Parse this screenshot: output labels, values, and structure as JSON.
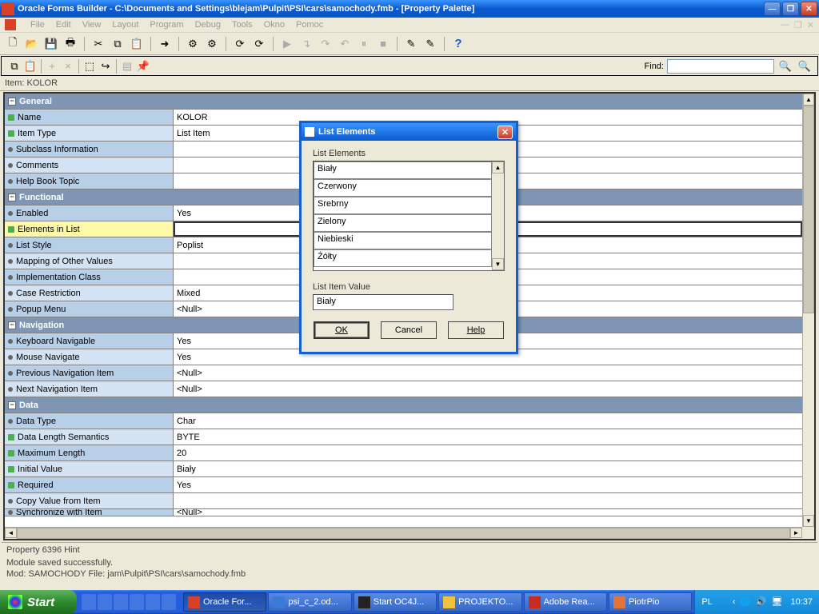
{
  "window": {
    "title": "Oracle Forms Builder - C:\\Documents and Settings\\blejam\\Pulpit\\PSI\\cars\\samochody.fmb - [Property Palette]"
  },
  "menu": {
    "file": "File",
    "edit": "Edit",
    "view": "View",
    "layout": "Layout",
    "program": "Program",
    "debug": "Debug",
    "tools": "Tools",
    "okno": "Okno",
    "pomoc": "Pomoc"
  },
  "subbar": {
    "find_label": "Find:"
  },
  "itembar": {
    "text": "Item: KOLOR"
  },
  "sections": {
    "general": "General",
    "functional": "Functional",
    "navigation": "Navigation",
    "data": "Data"
  },
  "props": {
    "name": {
      "l": "Name",
      "v": "KOLOR"
    },
    "item_type": {
      "l": "Item Type",
      "v": "List Item"
    },
    "subclass": {
      "l": "Subclass Information",
      "v": ""
    },
    "comments": {
      "l": "Comments",
      "v": ""
    },
    "help_book": {
      "l": "Help Book Topic",
      "v": ""
    },
    "enabled": {
      "l": "Enabled",
      "v": "Yes"
    },
    "elements_in_list": {
      "l": "Elements in List",
      "v": ""
    },
    "list_style": {
      "l": "List Style",
      "v": "Poplist"
    },
    "mapping": {
      "l": "Mapping of Other Values",
      "v": ""
    },
    "impl_class": {
      "l": "Implementation Class",
      "v": ""
    },
    "case_restrict": {
      "l": "Case Restriction",
      "v": "Mixed"
    },
    "popup_menu": {
      "l": "Popup Menu",
      "v": "<Null>"
    },
    "kbd_nav": {
      "l": "Keyboard Navigable",
      "v": "Yes"
    },
    "mouse_nav": {
      "l": "Mouse Navigate",
      "v": "Yes"
    },
    "prev_nav": {
      "l": "Previous Navigation Item",
      "v": "<Null>"
    },
    "next_nav": {
      "l": "Next Navigation Item",
      "v": "<Null>"
    },
    "data_type": {
      "l": "Data Type",
      "v": "Char"
    },
    "data_len_sem": {
      "l": "Data Length Semantics",
      "v": "BYTE"
    },
    "max_len": {
      "l": "Maximum Length",
      "v": "20"
    },
    "init_val": {
      "l": "Initial Value",
      "v": "Biały"
    },
    "required": {
      "l": "Required",
      "v": "Yes"
    },
    "copy_val": {
      "l": "Copy Value from Item",
      "v": ""
    },
    "sync": {
      "l": "Synchronize with Item",
      "v": "<Null>"
    }
  },
  "dialog": {
    "title": "List Elements",
    "list_label": "List Elements",
    "items": [
      "Biały",
      "Czerwony",
      "Srebrny",
      "Zielony",
      "Niebieski",
      "Żółty"
    ],
    "value_label": "List Item Value",
    "value": "Biały",
    "ok": "OK",
    "cancel": "Cancel",
    "help": "Help"
  },
  "status": {
    "hint": "Property 6396 Hint",
    "msg": "Module saved successfully.",
    "mod": "Mod: SAMOCHODY File: jam\\Pulpit\\PSI\\cars\\samochody.fmb"
  },
  "taskbar": {
    "start": "Start",
    "tasks": [
      {
        "l": "Oracle For...",
        "c": "#d84028"
      },
      {
        "l": "psi_c_2.od...",
        "c": "#3a7ad8"
      },
      {
        "l": "Start OC4J...",
        "c": "#222"
      },
      {
        "l": "PROJEKTO...",
        "c": "#f0c040"
      },
      {
        "l": "Adobe Rea...",
        "c": "#c82b1f"
      },
      {
        "l": "PiotrPio",
        "c": "#e0743a"
      }
    ],
    "lang": "PL",
    "clock": "10:37"
  }
}
